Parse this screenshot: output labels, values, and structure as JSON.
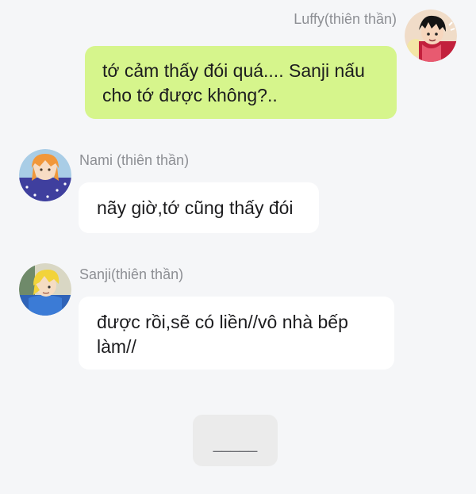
{
  "messages": [
    {
      "sender": "Luffy(thiên thần)",
      "text": "tớ cảm thấy đói quá.... Sanji nấu cho tớ được không?..",
      "side": "right",
      "bubble_color": "#d6f58c",
      "avatar_icon": "luffy-avatar-icon"
    },
    {
      "sender": "Nami (thiên thần)",
      "text": "nãy giờ,tớ cũng thấy đói",
      "side": "left",
      "bubble_color": "#ffffff",
      "avatar_icon": "nami-avatar-icon"
    },
    {
      "sender": "Sanji(thiên thần)",
      "text": "được rồi,sẽ có liền//vô nhà bếp làm//",
      "side": "left",
      "bubble_color": "#ffffff",
      "avatar_icon": "sanji-avatar-icon"
    }
  ],
  "typing_indicator": "_____",
  "colors": {
    "background": "#f5f6f8",
    "name_text": "#8d8f94",
    "typing_bg": "#ebebeb"
  }
}
